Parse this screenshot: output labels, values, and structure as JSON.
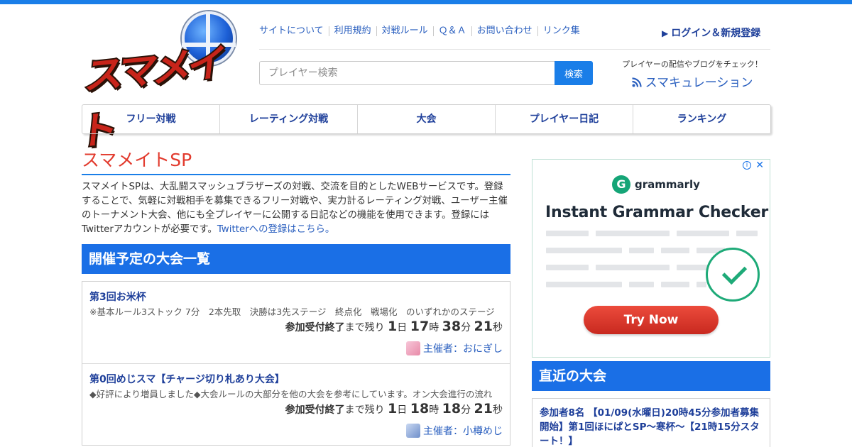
{
  "logo": {
    "text": "スマメイト"
  },
  "header": {
    "nav": [
      {
        "label": "サイトについて"
      },
      {
        "label": "利用規約"
      },
      {
        "label": "対戦ルール"
      },
      {
        "label": "Ｑ＆Ａ"
      },
      {
        "label": "お問い合わせ"
      },
      {
        "label": "リンク集"
      }
    ],
    "login_label": "ログイン＆新規登録",
    "search": {
      "placeholder": "プレイヤー検索",
      "button_label": "検索"
    },
    "curation": {
      "subtitle": "プレイヤーの配信やブログをチェック！",
      "title": "スマキュレーション"
    }
  },
  "main_nav": [
    {
      "label": "フリー対戦"
    },
    {
      "label": "レーティング対戦"
    },
    {
      "label": "大会"
    },
    {
      "label": "プレイヤー日記"
    },
    {
      "label": "ランキング"
    }
  ],
  "page": {
    "title": "スマメイトSP",
    "description": "スマメイトSPは、大乱闘スマッシュブラザーズの対戦、交流を目的としたWEBサービスです。登録することで、気軽に対戦相手を募集できるフリー対戦や、実力計るレーティング対戦、ユーザー主催のトーナメント大会、他にも全プレイヤーに公開する日記などの機能を使用できます。登録にはTwitterアカウントが必要です。",
    "twitter_link": "Twitterへの登録はこちら。"
  },
  "upcoming": {
    "heading": "開催予定の大会一覧",
    "items": [
      {
        "name": "第3回お米杯",
        "rules": "※基本ルール3ストック 7分　2本先取　決勝は3先ステージ　終点化　戦場化　のいずれかのステージ",
        "status": "参加受付終了",
        "remaining": "まで残り",
        "days": "1",
        "day_unit": "日",
        "hours": "17",
        "hour_unit": "時",
        "minutes": "38",
        "minute_unit": "分",
        "seconds": "21",
        "second_unit": "秒",
        "organizer": "主催者：おにぎし",
        "avatar_color": "#f2a7c3"
      },
      {
        "name": "第0回めじスマ【チャージ切り札あり大会】",
        "rules": "◆好評により増員しました◆大会ルールの大部分を他の大会を参考にしています。オン大会進行の流れ",
        "status": "参加受付終了",
        "remaining": "まで残り",
        "days": "1",
        "day_unit": "日",
        "hours": "18",
        "hour_unit": "時",
        "minutes": "18",
        "minute_unit": "分",
        "seconds": "21",
        "second_unit": "秒",
        "organizer": "主催者：小樽めじ",
        "avatar_color": "#7fa0d8"
      }
    ]
  },
  "ad": {
    "brand": "grammarly",
    "headline": "Instant Grammar Checker",
    "cta": "Try Now",
    "close": "✕",
    "info": "i"
  },
  "recent": {
    "heading": "直近の大会",
    "items": [
      {
        "text": "参加者8名 【01/09(水曜日)20時45分参加者募集開始】第1回ほにぱとSP～寒杯～【21時15分スタート！】"
      }
    ]
  },
  "colors": {
    "accent": "#1a7ee8",
    "heading_bg": "#1a6fe6",
    "title_red": "#e23b2e",
    "link": "#2a5fbf"
  }
}
